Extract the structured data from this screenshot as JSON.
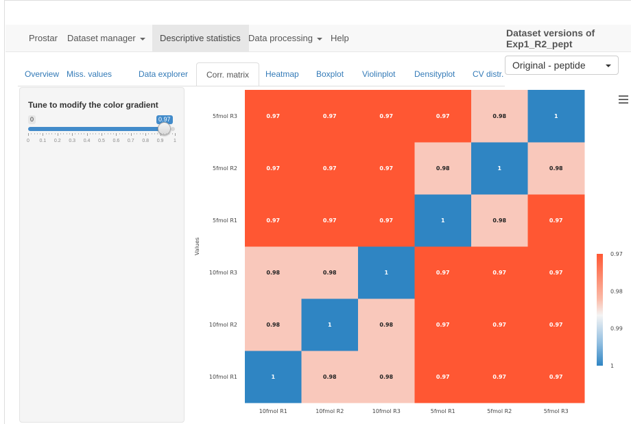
{
  "navbar": {
    "items": [
      {
        "label": "Prostar",
        "dropdown": false,
        "active": false
      },
      {
        "label": "Dataset manager",
        "dropdown": true,
        "active": false
      },
      {
        "label": "Descriptive statistics",
        "dropdown": false,
        "active": true
      },
      {
        "label": "Data processing",
        "dropdown": true,
        "active": false
      },
      {
        "label": "Help",
        "dropdown": false,
        "active": false
      }
    ]
  },
  "dataset_versions": {
    "title_line1": "Dataset versions of",
    "title_line2": "Exp1_R2_pept",
    "selected": "Original - peptide"
  },
  "tabs": [
    {
      "label": "Overview",
      "active": false
    },
    {
      "label": "Miss. values",
      "active": false
    },
    {
      "label": "Data explorer",
      "active": false
    },
    {
      "label": "Corr. matrix",
      "active": true
    },
    {
      "label": "Heatmap",
      "active": false
    },
    {
      "label": "Boxplot",
      "active": false
    },
    {
      "label": "Violinplot",
      "active": false
    },
    {
      "label": "Densityplot",
      "active": false
    },
    {
      "label": "CV distr.",
      "active": false
    }
  ],
  "sidebar": {
    "title": "Tune to modify the color gradient",
    "slider": {
      "min_label": "0",
      "value_label": "0.97",
      "value": 0.97,
      "tick_labels": [
        "0",
        "0.1",
        "0.2",
        "0.3",
        "0.4",
        "0.5",
        "0.6",
        "0.7",
        "0.8",
        "0.9",
        "1"
      ]
    }
  },
  "icons": {
    "menu": "hamburger-menu-icon"
  },
  "colors": {
    "high": "#ff5733",
    "mid": "#f9c8bb",
    "one": "#2f85c3",
    "accent": "#428bca"
  },
  "chart_data": {
    "type": "heatmap",
    "ylabel": "Values",
    "x_categories": [
      "10fmol R1",
      "10fmol R2",
      "10fmol R3",
      "5fmol R1",
      "5fmol R2",
      "5fmol R3"
    ],
    "y_categories": [
      "10fmol R1",
      "10fmol R2",
      "10fmol R3",
      "5fmol R1",
      "5fmol R2",
      "5fmol R3"
    ],
    "cells": [
      [
        "1",
        "0.98",
        "0.98",
        "0.97",
        "0.97",
        "0.97"
      ],
      [
        "0.98",
        "1",
        "0.98",
        "0.97",
        "0.97",
        "0.97"
      ],
      [
        "0.98",
        "0.98",
        "1",
        "0.97",
        "0.97",
        "0.97"
      ],
      [
        "0.97",
        "0.97",
        "0.97",
        "1",
        "0.98",
        "0.97"
      ],
      [
        "0.97",
        "0.97",
        "0.97",
        "0.98",
        "1",
        "0.98"
      ],
      [
        "0.97",
        "0.97",
        "0.97",
        "0.97",
        "0.98",
        "1"
      ]
    ],
    "colorbar_labels": [
      "0.97",
      "0.98",
      "0.99",
      "1"
    ]
  }
}
